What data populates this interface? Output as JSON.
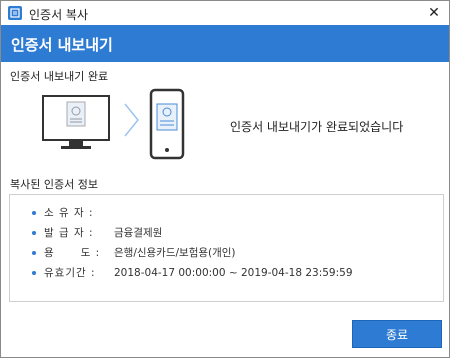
{
  "window": {
    "title": "인증서 복사"
  },
  "header": {
    "title": "인증서 내보내기"
  },
  "export": {
    "section_label": "인증서 내보내기 완료",
    "message": "인증서 내보내기가 완료되었습니다"
  },
  "info": {
    "section_label": "복사된 인증서 정보",
    "rows": [
      {
        "label": "소 유 자 :",
        "value": ""
      },
      {
        "label": "발 급 자 :",
        "value": "금융결제원"
      },
      {
        "label": "용      도 :",
        "value": "은행/신용카드/보험용(개인)"
      },
      {
        "label": "유효기간 :",
        "value": "2018-04-17 00:00:00 ~ 2019-04-18 23:59:59"
      }
    ]
  },
  "buttons": {
    "close_label": "종료"
  },
  "colors": {
    "accent": "#2e7bd3"
  },
  "icons": {
    "app": "certificate-copy-icon",
    "close": "close-icon",
    "monitor": "monitor-certificate-icon",
    "arrow": "chevron-right-icon",
    "phone": "phone-certificate-icon"
  }
}
